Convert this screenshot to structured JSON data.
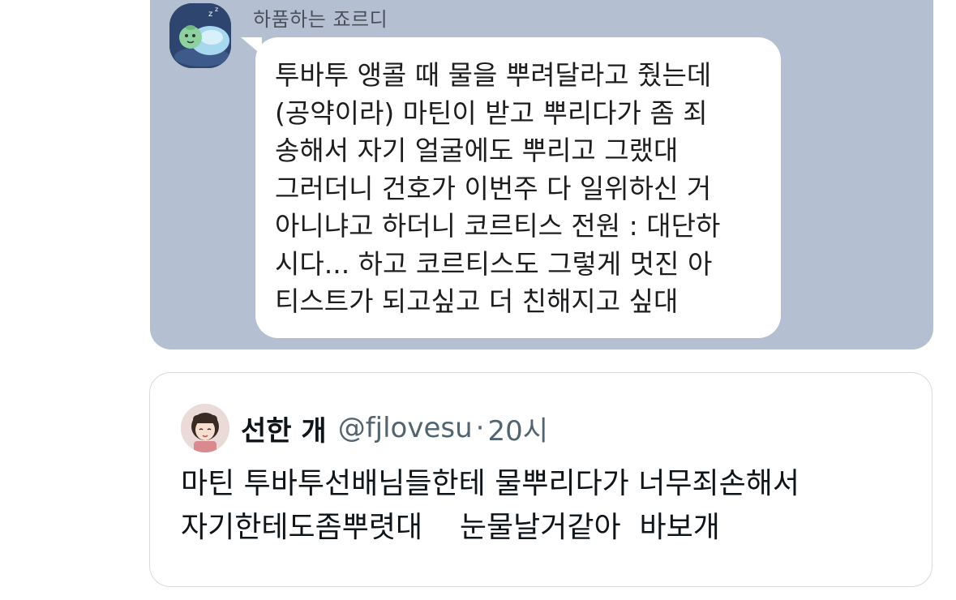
{
  "chat": {
    "sender_name": "하품하는 죠르디",
    "avatar_icon": "jordy-character-avatar",
    "background_color": "#b4c0d1",
    "message_lines": [
      "투바투 앵콜 때 물을 뿌려달라고 줬는데",
      "(공약이라) 마틴이 받고 뿌리다가 좀 죄",
      "송해서 자기 얼굴에도 뿌리고 그랬대",
      "그러더니 건호가 이번주 다 일위하신 거",
      "아니냐고 하더니 코르티스 전원 : 대단하",
      "시다... 하고 코르티스도 그렇게 멋진 아",
      "티스트가 되고싶고 더 친해지고 싶대"
    ]
  },
  "quote": {
    "avatar_icon": "profile-avatar",
    "display_name": "선한 개",
    "handle": "@fjlovesu",
    "separator": "·",
    "time": "20시",
    "body_lines": [
      "마틴 투바투선배님들한테 물뿌리다가 너무죄손해서",
      "자기한테도좀뿌렷대    눈물날거같아  바보개"
    ]
  }
}
